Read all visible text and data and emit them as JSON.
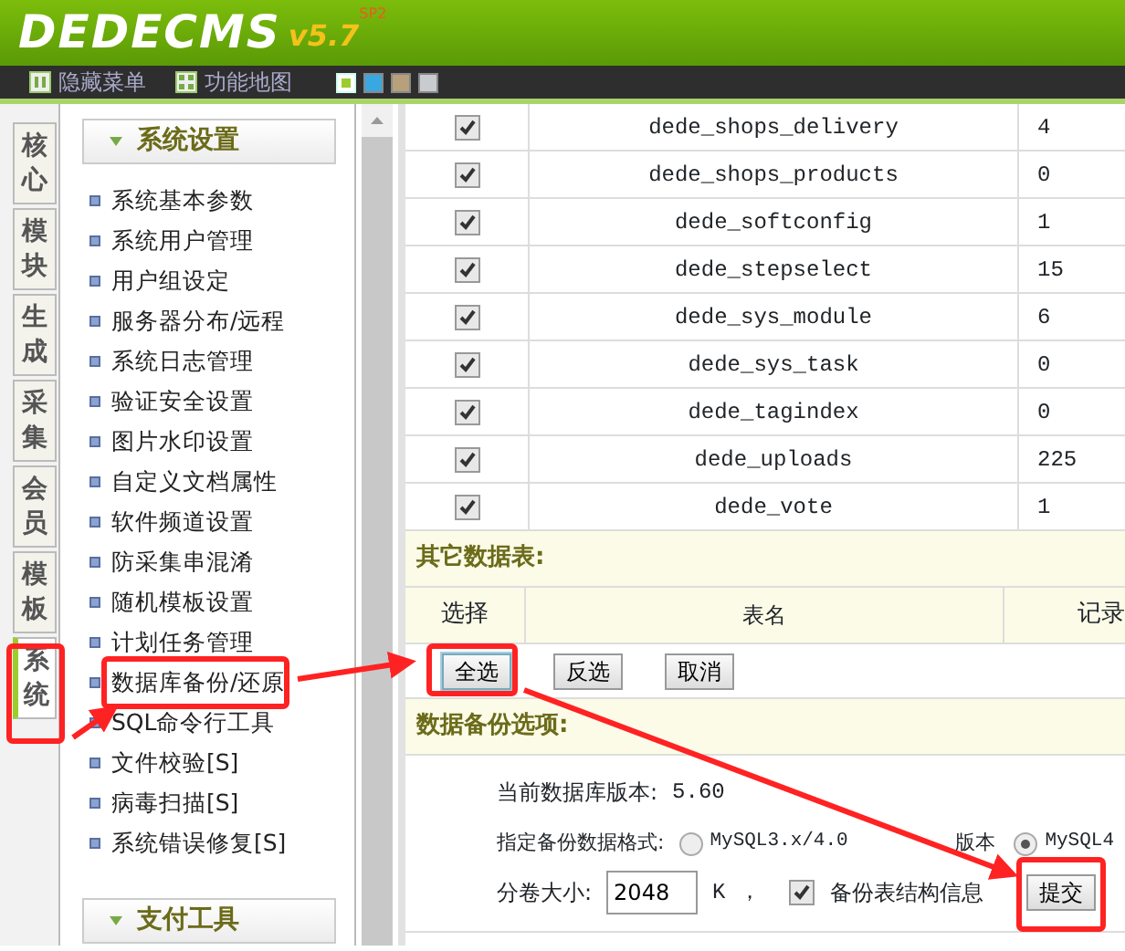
{
  "logo": {
    "brand": "DEDECMS",
    "version": "v5.7",
    "edition": "SP2"
  },
  "toolbar": {
    "items": [
      {
        "label": "隐藏菜单",
        "kind": "hide"
      },
      {
        "label": "功能地图",
        "kind": "map"
      }
    ],
    "skins": [
      {
        "color": "#9ccc2e",
        "selected": true
      },
      {
        "color": "#3aa8e0",
        "selected": false
      },
      {
        "color": "#b8a07a",
        "selected": false
      },
      {
        "color": "#c8ccd0",
        "selected": false
      }
    ]
  },
  "side_tabs": [
    {
      "label": "核心",
      "selected": false
    },
    {
      "label": "模块",
      "selected": false
    },
    {
      "label": "生成",
      "selected": false
    },
    {
      "label": "采集",
      "selected": false
    },
    {
      "label": "会员",
      "selected": false
    },
    {
      "label": "模板",
      "selected": false
    },
    {
      "label": "系统",
      "selected": true
    }
  ],
  "menu": [
    {
      "title": "系统设置",
      "expanded": true,
      "items": [
        "系统基本参数",
        "系统用户管理",
        "用户组设定",
        "服务器分布/远程",
        "系统日志管理",
        "验证安全设置",
        "图片水印设置",
        "自定义文档属性",
        "软件频道设置",
        "防采集串混淆",
        "随机模板设置",
        "计划任务管理",
        "数据库备份/还原",
        "SQL命令行工具",
        "文件校验[S]",
        "病毒扫描[S]",
        "系统错误修复[S]"
      ]
    },
    {
      "title": "支付工具",
      "expanded": true
    }
  ],
  "tables": {
    "rows": [
      {
        "name": "dede_shops_delivery",
        "records": "4",
        "checked": true
      },
      {
        "name": "dede_shops_products",
        "records": "0",
        "checked": true
      },
      {
        "name": "dede_softconfig",
        "records": "1",
        "checked": true
      },
      {
        "name": "dede_stepselect",
        "records": "15",
        "checked": true
      },
      {
        "name": "dede_sys_module",
        "records": "6",
        "checked": true
      },
      {
        "name": "dede_sys_task",
        "records": "0",
        "checked": true
      },
      {
        "name": "dede_tagindex",
        "records": "0",
        "checked": true
      },
      {
        "name": "dede_uploads",
        "records": "225",
        "checked": true
      },
      {
        "name": "dede_vote",
        "records": "1",
        "checked": true
      }
    ]
  },
  "other_tables": {
    "title": "其它数据表:",
    "columns": [
      "选择",
      "表名",
      "记录"
    ],
    "buttons": [
      "全选",
      "反选",
      "取消"
    ]
  },
  "backup_options": {
    "title": "数据备份选项:",
    "version_label": "当前数据库版本:",
    "version": "5.60",
    "format_label": "指定备份数据格式:",
    "formats": [
      {
        "label": "MySQL3.x/4.0",
        "selected": false
      },
      {
        "label": "版本",
        "kind": "text"
      },
      {
        "label": "MySQL4",
        "selected": true
      }
    ],
    "volume_label": "分卷大小:",
    "volume": "2048",
    "unit": "K ，",
    "structure": {
      "label": "备份表结构信息",
      "checked": true
    },
    "submit": "提交"
  }
}
